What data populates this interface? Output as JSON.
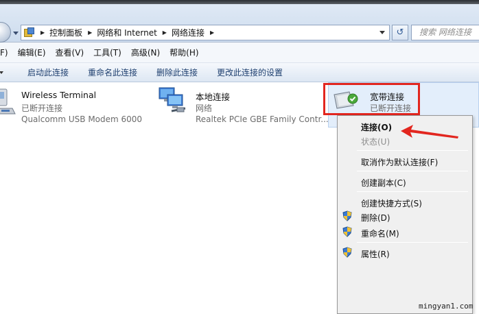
{
  "breadcrumb": {
    "items": [
      "控制面板",
      "网络和 Internet",
      "网络连接"
    ]
  },
  "search": {
    "placeholder": "搜索 网络连接"
  },
  "menu": {
    "items": [
      "F)",
      "编辑(E)",
      "查看(V)",
      "工具(T)",
      "高级(N)",
      "帮助(H)"
    ]
  },
  "commands": {
    "items": [
      "启动此连接",
      "重命名此连接",
      "删除此连接",
      "更改此连接的设置"
    ]
  },
  "connections": [
    {
      "name": "Wireless Terminal",
      "status": "已断开连接",
      "device": "Qualcomm USB Modem 6000"
    },
    {
      "name": "本地连接",
      "status": "网络",
      "device": "Realtek PCIe GBE Family Contr..."
    },
    {
      "name": "宽带连接",
      "status": "已断开连接",
      "device": ""
    }
  ],
  "context_menu": {
    "connect": "连接(O)",
    "status": "状态(U)",
    "cancel_default": "取消作为默认连接(F)",
    "copy": "创建副本(C)",
    "shortcut": "创建快捷方式(S)",
    "delete": "删除(D)",
    "rename": "重命名(M)",
    "properties": "属性(R)"
  },
  "icons": {
    "nav": "back-forward-icon",
    "control_panel": "control-panel-icon",
    "refresh": "refresh-icon",
    "modem": "usb-modem-icon",
    "lan": "lan-computers-icon",
    "broadband": "broadband-connected-icon",
    "shield": "uac-shield-icon"
  },
  "colors": {
    "highlight_border": "#e2261f",
    "annotation_arrow": "#e2261f",
    "selection_bg": "#e3eefb"
  },
  "watermark": "mingyan1.com"
}
